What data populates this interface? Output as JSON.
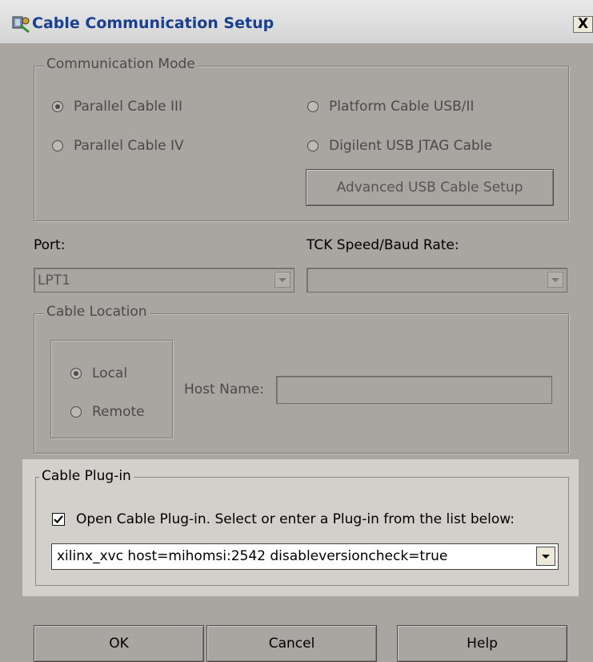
{
  "window": {
    "title": "Cable Communication Setup",
    "close_label": "X"
  },
  "communication_mode": {
    "legend": "Communication Mode",
    "options": [
      {
        "label": "Parallel Cable III",
        "selected": true
      },
      {
        "label": "Parallel Cable IV",
        "selected": false
      },
      {
        "label": "Platform Cable USB/II",
        "selected": false
      },
      {
        "label": "Digilent USB JTAG Cable",
        "selected": false
      }
    ],
    "advanced_button": "Advanced USB Cable Setup"
  },
  "port": {
    "label": "Port:",
    "value": "LPT1"
  },
  "tck": {
    "label": "TCK Speed/Baud Rate:",
    "value": ""
  },
  "cable_location": {
    "legend": "Cable Location",
    "local_label": "Local",
    "remote_label": "Remote",
    "selected": "Local",
    "host_name_label": "Host Name:",
    "host_name_value": ""
  },
  "cable_plugin": {
    "legend": "Cable Plug-in",
    "checkbox_label": "Open Cable Plug-in. Select or enter a Plug-in from the list below:",
    "checked": true,
    "value": "xilinx_xvc host=mihomsi:2542 disableversioncheck=true"
  },
  "buttons": {
    "ok": "OK",
    "cancel": "Cancel",
    "help": "Help"
  }
}
